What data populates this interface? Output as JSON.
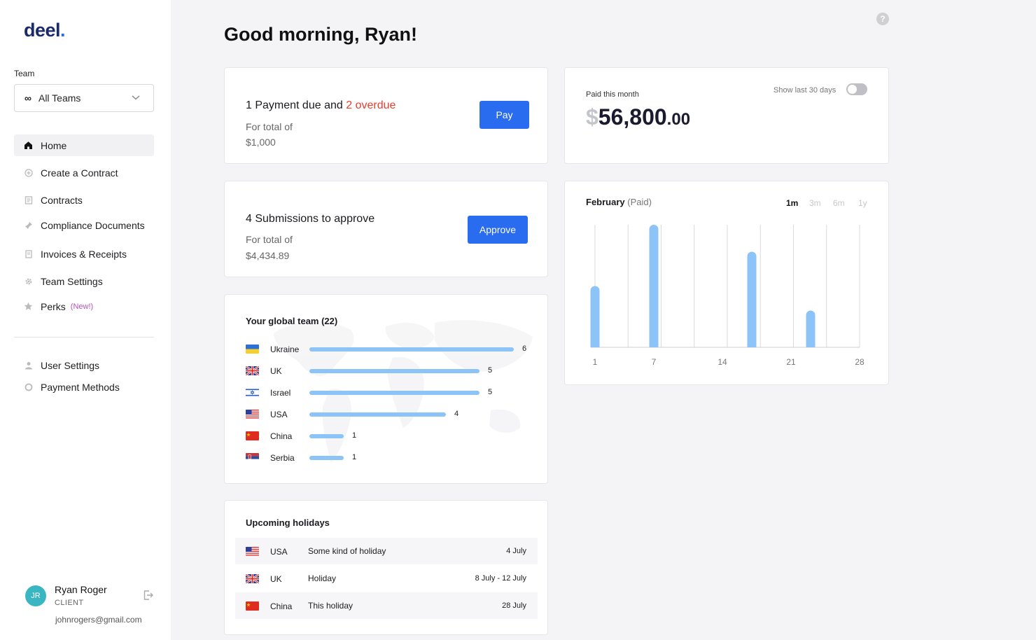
{
  "brand": {
    "name": "deel",
    "dot": "."
  },
  "sidebar": {
    "team_label": "Team",
    "team_select": {
      "icon": "infinity-icon",
      "value": "All Teams"
    },
    "nav": [
      {
        "label": "Home",
        "icon": "home-icon",
        "active": true
      },
      {
        "label": "Create a Contract",
        "icon": "plus-circle-icon"
      },
      {
        "label": "Contracts",
        "icon": "document-icon"
      },
      {
        "label": "Compliance Documents",
        "icon": "pin-icon"
      },
      {
        "label": "Invoices & Receipts",
        "icon": "receipt-icon"
      },
      {
        "label": "Team Settings",
        "icon": "gear-icon"
      },
      {
        "label": "Perks",
        "icon": "star-icon",
        "badge": "(New!)"
      }
    ],
    "secondary_nav": [
      {
        "label": "User Settings",
        "icon": "user-icon"
      },
      {
        "label": "Payment Methods",
        "icon": "circle-icon"
      }
    ],
    "user": {
      "initials": "JR",
      "name": "Ryan Roger",
      "role": "CLIENT",
      "email": "johnrogers@gmail.com"
    }
  },
  "main": {
    "greeting": "Good morning, Ryan!",
    "help": "?",
    "payment_card": {
      "title_prefix": "1 Payment due and ",
      "title_overdue": "2 overdue",
      "sub_label": "For total of",
      "sub_value": "$1,000",
      "button": "Pay"
    },
    "approve_card": {
      "title": "4 Submissions to approve",
      "sub_label": "For total of",
      "sub_value": "$4,434.89",
      "button": "Approve"
    },
    "global_team": {
      "title": "Your global team (22)",
      "countries": [
        {
          "name": "Ukraine",
          "count": 6,
          "flag": "ukraine"
        },
        {
          "name": "UK",
          "count": 5,
          "flag": "uk"
        },
        {
          "name": "Israel",
          "count": 5,
          "flag": "israel"
        },
        {
          "name": "USA",
          "count": 4,
          "flag": "usa"
        },
        {
          "name": "China",
          "count": 1,
          "flag": "china"
        },
        {
          "name": "Serbia",
          "count": 1,
          "flag": "serbia"
        }
      ]
    },
    "holidays": {
      "title": "Upcoming holidays",
      "rows": [
        {
          "country": "USA",
          "flag": "usa",
          "name": "Some kind of holiday",
          "date": "4 July"
        },
        {
          "country": "UK",
          "flag": "uk",
          "name": "Holiday",
          "date": "8 July - 12 July"
        },
        {
          "country": "China",
          "flag": "china",
          "name": "This holiday",
          "date": "28 July"
        }
      ]
    },
    "paid_card": {
      "label": "Paid this month",
      "currency": "$",
      "amount": "56,800",
      "cents": ".00",
      "toggle_label": "Show last 30 days",
      "toggle_on": false
    },
    "chart_card": {
      "month": "February",
      "status": "(Paid)",
      "ranges": [
        {
          "label": "1m",
          "active": true
        },
        {
          "label": "3m",
          "active": false
        },
        {
          "label": "6m",
          "active": false
        },
        {
          "label": "1y",
          "active": false
        }
      ]
    }
  },
  "chart_data": {
    "type": "bar",
    "x": [
      1,
      7,
      17,
      23
    ],
    "values": [
      0.5,
      1.0,
      0.78,
      0.3
    ],
    "xticks": [
      1,
      7,
      14,
      21,
      28
    ],
    "xlim": [
      1,
      28
    ],
    "ylim": [
      0,
      1
    ],
    "gridlines": 9,
    "bar_color": "#8cc4f7"
  },
  "colors": {
    "accent": "#2a6cf0",
    "overdue": "#ee3b2b",
    "bar": "#8cc4f7",
    "avatar": "#3ab6c3",
    "perks_badge": "#b64fbd"
  }
}
